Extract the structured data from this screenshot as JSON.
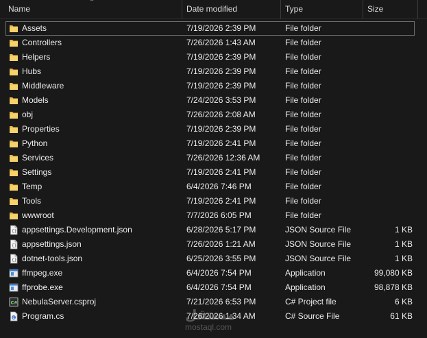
{
  "columns": {
    "name": "Name",
    "date": "Date modified",
    "type": "Type",
    "size": "Size"
  },
  "rows": [
    {
      "name": "Assets",
      "date": "7/19/2026 2:39 PM",
      "type": "File folder",
      "size": "",
      "icon": "folder-icon"
    },
    {
      "name": "Controllers",
      "date": "7/26/2026 1:43 AM",
      "type": "File folder",
      "size": "",
      "icon": "folder-icon"
    },
    {
      "name": "Helpers",
      "date": "7/19/2026 2:39 PM",
      "type": "File folder",
      "size": "",
      "icon": "folder-icon"
    },
    {
      "name": "Hubs",
      "date": "7/19/2026 2:39 PM",
      "type": "File folder",
      "size": "",
      "icon": "folder-icon"
    },
    {
      "name": "Middleware",
      "date": "7/19/2026 2:39 PM",
      "type": "File folder",
      "size": "",
      "icon": "folder-icon"
    },
    {
      "name": "Models",
      "date": "7/24/2026 3:53 PM",
      "type": "File folder",
      "size": "",
      "icon": "folder-icon"
    },
    {
      "name": "obj",
      "date": "7/26/2026 2:08 AM",
      "type": "File folder",
      "size": "",
      "icon": "folder-icon"
    },
    {
      "name": "Properties",
      "date": "7/19/2026 2:39 PM",
      "type": "File folder",
      "size": "",
      "icon": "folder-icon"
    },
    {
      "name": "Python",
      "date": "7/19/2026 2:41 PM",
      "type": "File folder",
      "size": "",
      "icon": "folder-icon"
    },
    {
      "name": "Services",
      "date": "7/26/2026 12:36 AM",
      "type": "File folder",
      "size": "",
      "icon": "folder-icon"
    },
    {
      "name": "Settings",
      "date": "7/19/2026 2:41 PM",
      "type": "File folder",
      "size": "",
      "icon": "folder-icon"
    },
    {
      "name": "Temp",
      "date": "6/4/2026 7:46 PM",
      "type": "File folder",
      "size": "",
      "icon": "folder-icon"
    },
    {
      "name": "Tools",
      "date": "7/19/2026 2:41 PM",
      "type": "File folder",
      "size": "",
      "icon": "folder-icon"
    },
    {
      "name": "wwwroot",
      "date": "7/7/2026 6:05 PM",
      "type": "File folder",
      "size": "",
      "icon": "folder-icon"
    },
    {
      "name": "appsettings.Development.json",
      "date": "6/28/2026 5:17 PM",
      "type": "JSON Source File",
      "size": "1 KB",
      "icon": "json-file-icon"
    },
    {
      "name": "appsettings.json",
      "date": "7/26/2026 1:21 AM",
      "type": "JSON Source File",
      "size": "1 KB",
      "icon": "json-file-icon"
    },
    {
      "name": "dotnet-tools.json",
      "date": "6/25/2026 3:55 PM",
      "type": "JSON Source File",
      "size": "1 KB",
      "icon": "json-file-icon"
    },
    {
      "name": "ffmpeg.exe",
      "date": "6/4/2026 7:54 PM",
      "type": "Application",
      "size": "99,080 KB",
      "icon": "exe-icon"
    },
    {
      "name": "ffprobe.exe",
      "date": "6/4/2026 7:54 PM",
      "type": "Application",
      "size": "98,878 KB",
      "icon": "exe-icon"
    },
    {
      "name": "NebulaServer.csproj",
      "date": "7/21/2026 6:53 PM",
      "type": "C# Project file",
      "size": "6 KB",
      "icon": "csproj-icon"
    },
    {
      "name": "Program.cs",
      "date": "7/26/2026 1:34 AM",
      "type": "C# Source File",
      "size": "61 KB",
      "icon": "cs-file-icon"
    }
  ],
  "watermark": {
    "brand": "مستقل",
    "site": "mostaql.com"
  }
}
